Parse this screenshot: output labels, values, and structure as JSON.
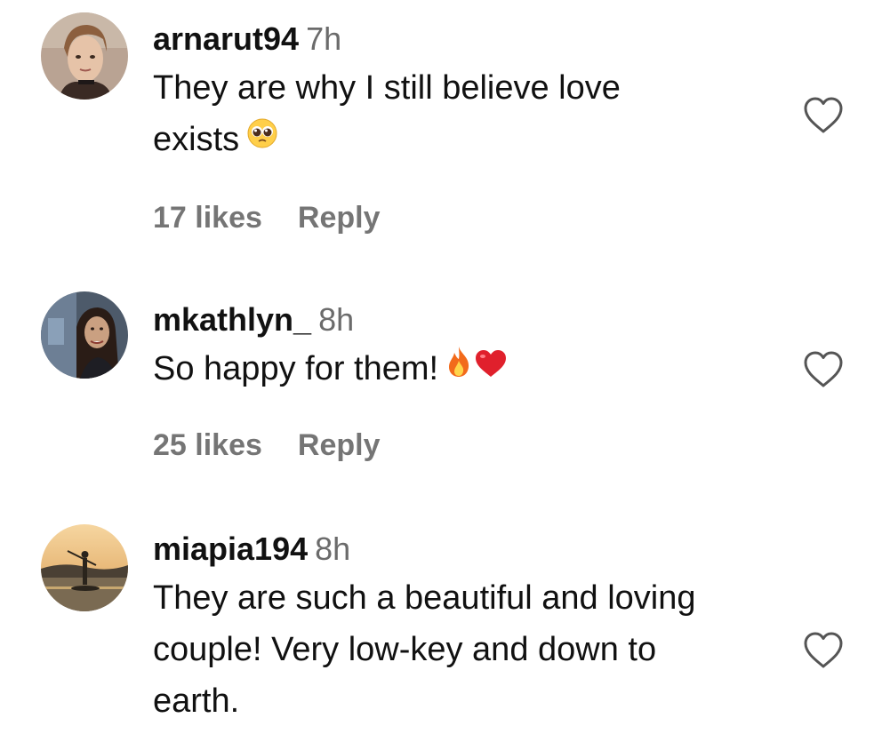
{
  "comments": [
    {
      "username": "arnarut94",
      "time": "7h",
      "text": "They are why I still believe love exists",
      "emoji": "pleading-face",
      "likes": "17 likes",
      "reply": "Reply"
    },
    {
      "username": "mkathlyn_",
      "time": "8h",
      "text": "So happy for them!",
      "emoji": "fire-and-red-heart",
      "likes": "25 likes",
      "reply": "Reply"
    },
    {
      "username": "miapia194",
      "time": "8h",
      "text": "They are such a beautiful and loving couple! Very low-key and down to earth.",
      "emoji": "",
      "likes": "",
      "reply": ""
    }
  ]
}
